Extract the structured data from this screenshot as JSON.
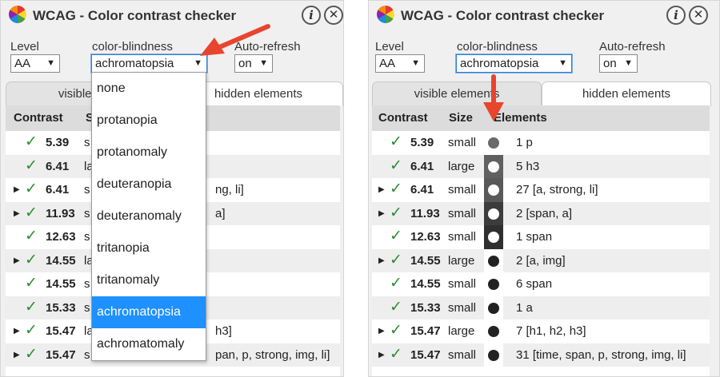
{
  "app": {
    "title": "WCAG - Color contrast checker",
    "info_glyph": "i",
    "close_glyph": "✕"
  },
  "labels": {
    "level": "Level",
    "color_blindness": "color-blindness",
    "auto_refresh": "Auto-refresh"
  },
  "left": {
    "level_value": "AA",
    "cb_value": "achromatopsia",
    "auto_value": "on",
    "tab_visible": "visible elem",
    "tab_hidden": "hidden elements",
    "header_contrast": "Contrast",
    "header_size": "S",
    "rows": [
      {
        "exp": "",
        "contrast": "5.39",
        "size": "s",
        "tail": ""
      },
      {
        "exp": "",
        "contrast": "6.41",
        "size": "la",
        "tail": ""
      },
      {
        "exp": "▶",
        "contrast": "6.41",
        "size": "s",
        "tail": "ng, li]"
      },
      {
        "exp": "▶",
        "contrast": "11.93",
        "size": "s",
        "tail": "a]"
      },
      {
        "exp": "",
        "contrast": "12.63",
        "size": "s",
        "tail": ""
      },
      {
        "exp": "▶",
        "contrast": "14.55",
        "size": "la",
        "tail": ""
      },
      {
        "exp": "",
        "contrast": "14.55",
        "size": "s",
        "tail": ""
      },
      {
        "exp": "",
        "contrast": "15.33",
        "size": "s",
        "tail": ""
      },
      {
        "exp": "▶",
        "contrast": "15.47",
        "size": "la",
        "tail": "h3]"
      },
      {
        "exp": "▶",
        "contrast": "15.47",
        "size": "s",
        "tail": "pan, p, strong, img, li]"
      }
    ],
    "dropdown_options": [
      "none",
      "protanopia",
      "protanomaly",
      "deuteranopia",
      "deuteranomaly",
      "tritanopia",
      "tritanomaly",
      "achromatopsia",
      "achromatomaly"
    ],
    "dropdown_selected_index": 7
  },
  "right": {
    "level_value": "AA",
    "cb_value": "achromatopsia",
    "auto_value": "on",
    "tab_visible": "visible elements",
    "tab_hidden": "hidden elements",
    "header_contrast": "Contrast",
    "header_size": "Size",
    "header_elements": "Elements",
    "rows": [
      {
        "exp": "",
        "contrast": "5.39",
        "size": "small",
        "elements": "1 p"
      },
      {
        "exp": "",
        "contrast": "6.41",
        "size": "large",
        "elements": "5 h3"
      },
      {
        "exp": "▶",
        "contrast": "6.41",
        "size": "small",
        "elements": "27 [a, strong, li]"
      },
      {
        "exp": "▶",
        "contrast": "11.93",
        "size": "small",
        "elements": "2 [span, a]"
      },
      {
        "exp": "",
        "contrast": "12.63",
        "size": "small",
        "elements": "1 span"
      },
      {
        "exp": "▶",
        "contrast": "14.55",
        "size": "large",
        "elements": "2 [a, img]"
      },
      {
        "exp": "",
        "contrast": "14.55",
        "size": "small",
        "elements": "6 span"
      },
      {
        "exp": "",
        "contrast": "15.33",
        "size": "small",
        "elements": "1 a"
      },
      {
        "exp": "▶",
        "contrast": "15.47",
        "size": "large",
        "elements": "7 [h1, h2, h3]"
      },
      {
        "exp": "▶",
        "contrast": "15.47",
        "size": "small",
        "elements": "31 [time, span, p, strong, img, li]"
      }
    ],
    "swatch_bg": [
      "#ffffff",
      "#606060",
      "#595959",
      "#3c3c3c",
      "#2f2f2f",
      "#ffffff",
      "#ffffff",
      "#ffffff",
      "#ffffff",
      "#ffffff"
    ],
    "swatch_fg": [
      "#6a6a6a",
      "#ffffff",
      "#ffffff",
      "#ffffff",
      "#ffffff",
      "#222222",
      "#222222",
      "#222222",
      "#222222",
      "#222222"
    ]
  },
  "colors": {
    "annotation_arrow": "#e8452e",
    "check": "#2e8b2e",
    "dropdown_selected": "#1e90ff"
  }
}
